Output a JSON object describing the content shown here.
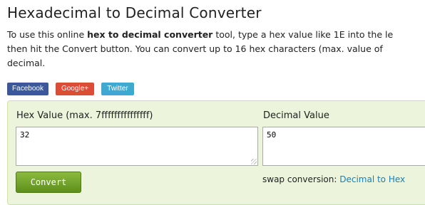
{
  "header": {
    "title": "Hexadecimal to Decimal Converter"
  },
  "description": {
    "line1_pre": "To use this online ",
    "line1_bold": "hex to decimal converter",
    "line1_post": " tool, type a hex value like 1E into the le",
    "line2": "then hit the Convert button. You can convert up to 16 hex characters (max. value of",
    "line3": "decimal."
  },
  "social": {
    "facebook": "Facebook",
    "googleplus": "Google+",
    "twitter": "Twitter"
  },
  "converter": {
    "hex_label": "Hex Value (max. 7fffffffffffffff)",
    "hex_value": "32",
    "decimal_label": "Decimal Value",
    "decimal_value": "50",
    "convert_button": "Convert",
    "swap_prefix": "swap conversion: ",
    "swap_link": "Decimal to Hex"
  },
  "colors": {
    "panel_bg": "#ecf5dc",
    "convert_green": "#6fa02a",
    "link_blue": "#1a7fb5"
  }
}
